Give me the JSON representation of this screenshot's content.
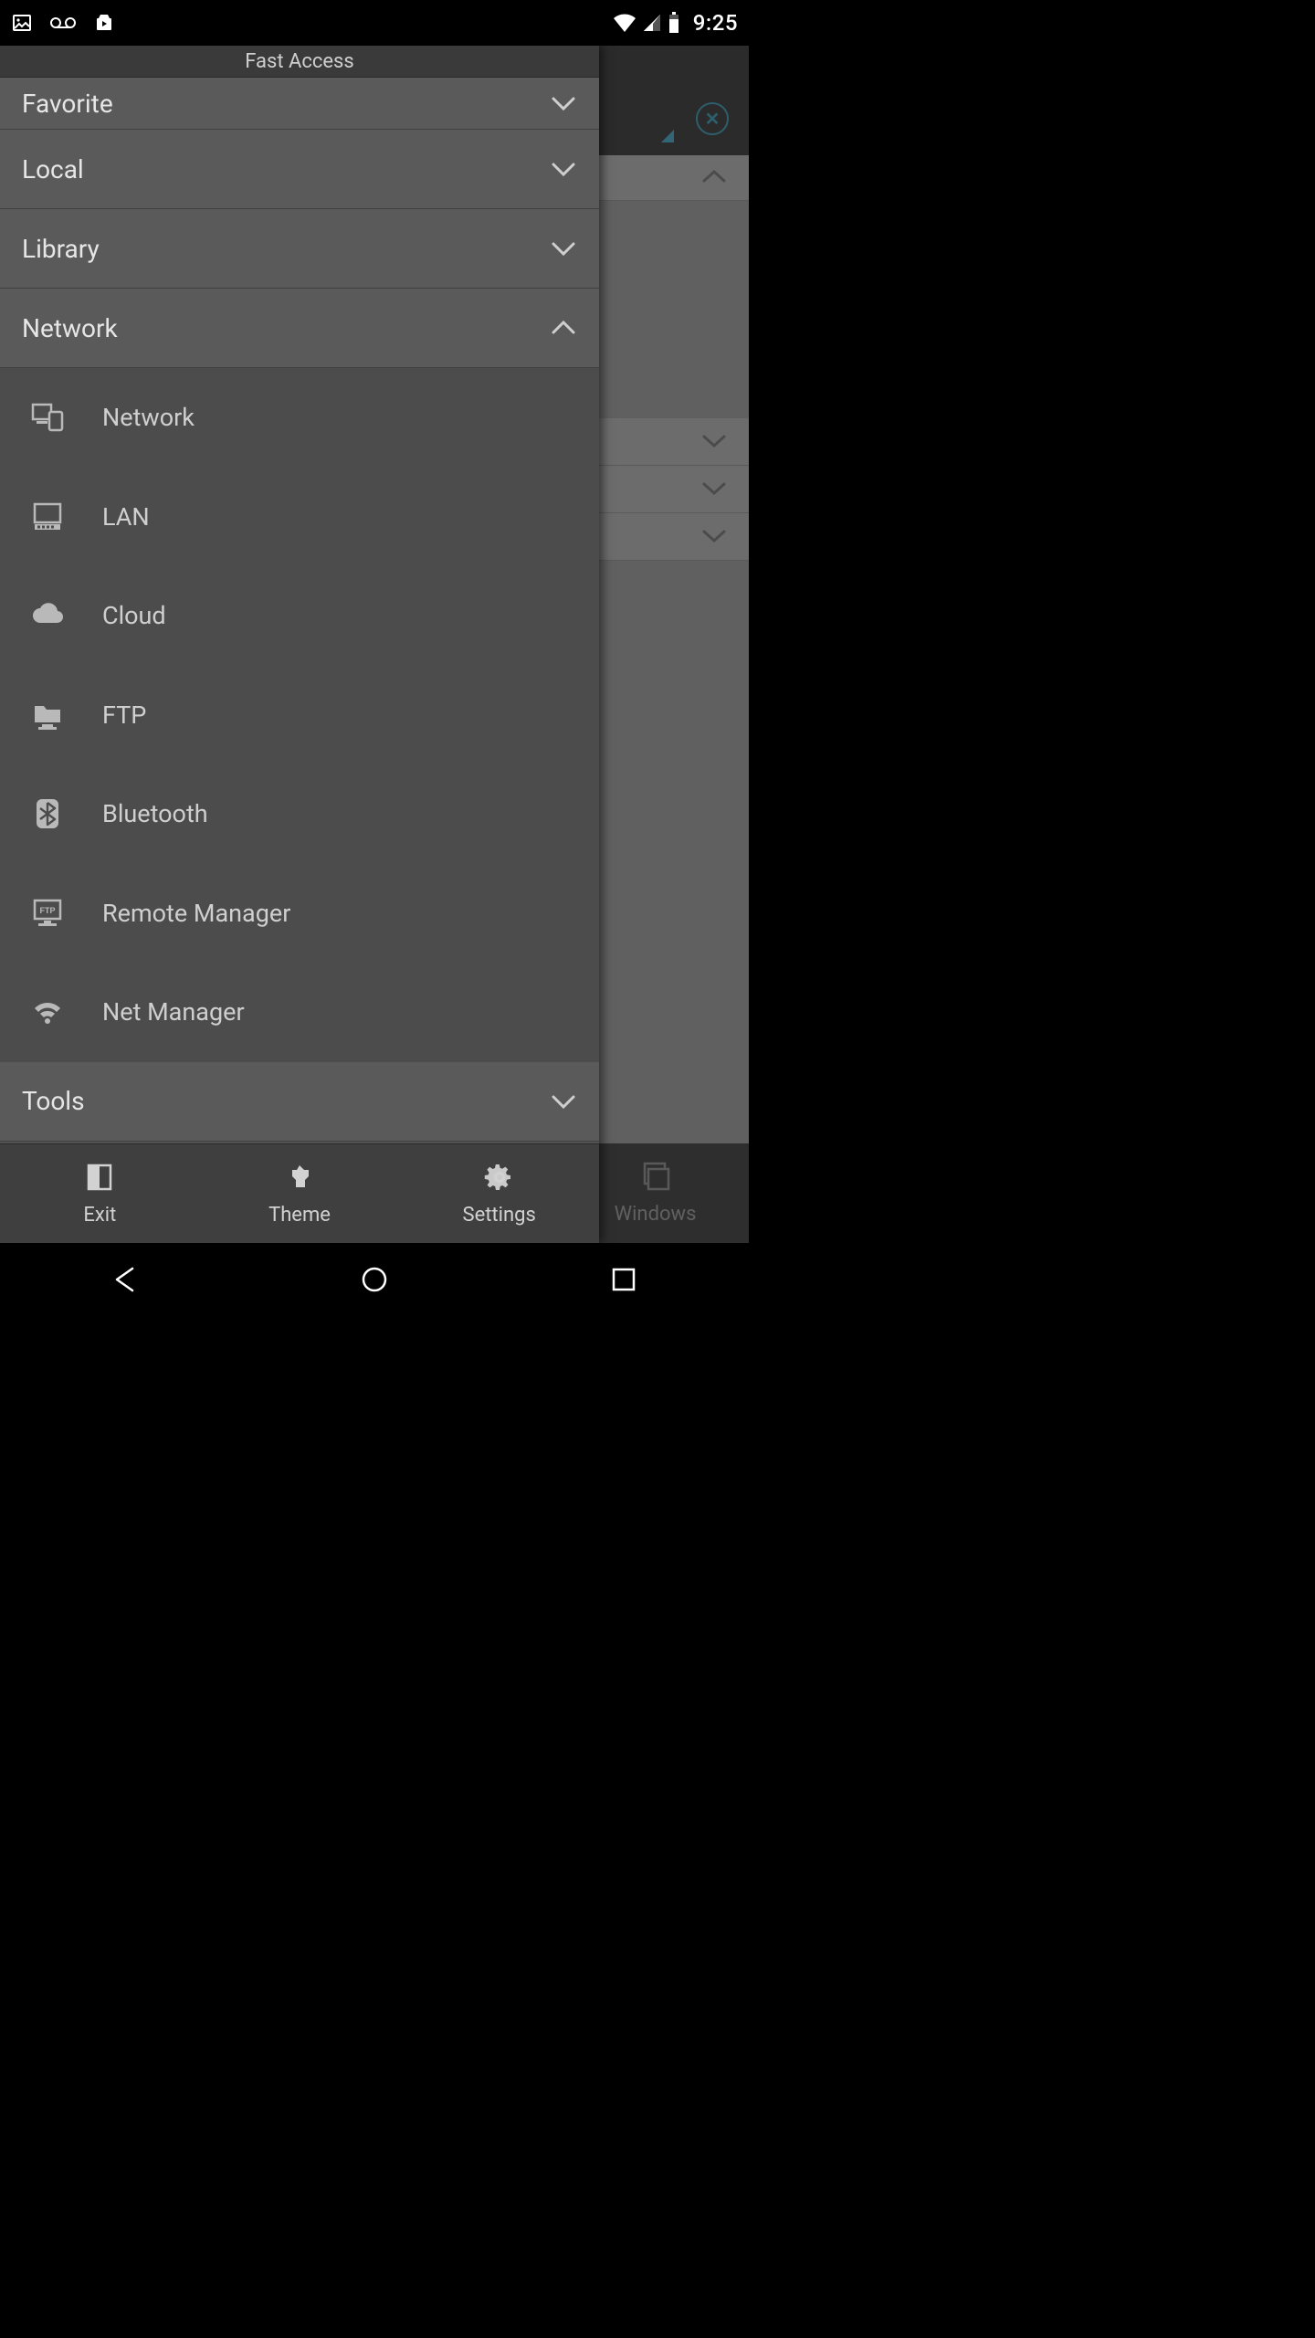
{
  "status_bar": {
    "time": "9:25"
  },
  "drawer": {
    "title": "Fast Access",
    "sections": [
      {
        "label": "Favorite",
        "expanded": false
      },
      {
        "label": "Local",
        "expanded": false
      },
      {
        "label": "Library",
        "expanded": false
      },
      {
        "label": "Network",
        "expanded": true
      },
      {
        "label": "Tools",
        "expanded": false
      }
    ],
    "network_items": [
      {
        "label": "Network",
        "icon": "devices-icon"
      },
      {
        "label": "LAN",
        "icon": "computer-icon"
      },
      {
        "label": "Cloud",
        "icon": "cloud-icon"
      },
      {
        "label": "FTP",
        "icon": "folder-server-icon"
      },
      {
        "label": "Bluetooth",
        "icon": "bluetooth-icon"
      },
      {
        "label": "Remote Manager",
        "icon": "ftp-monitor-icon"
      },
      {
        "label": "Net Manager",
        "icon": "wifi-gear-icon"
      }
    ],
    "footer": {
      "exit": "Exit",
      "theme": "Theme",
      "settings": "Settings"
    }
  },
  "background": {
    "bottom_bar": {
      "windows": "Windows"
    }
  },
  "colors": {
    "accent": "#36a9cf",
    "drawer_bg": "#535353",
    "drawer_sub_bg": "#4c4c4c"
  }
}
